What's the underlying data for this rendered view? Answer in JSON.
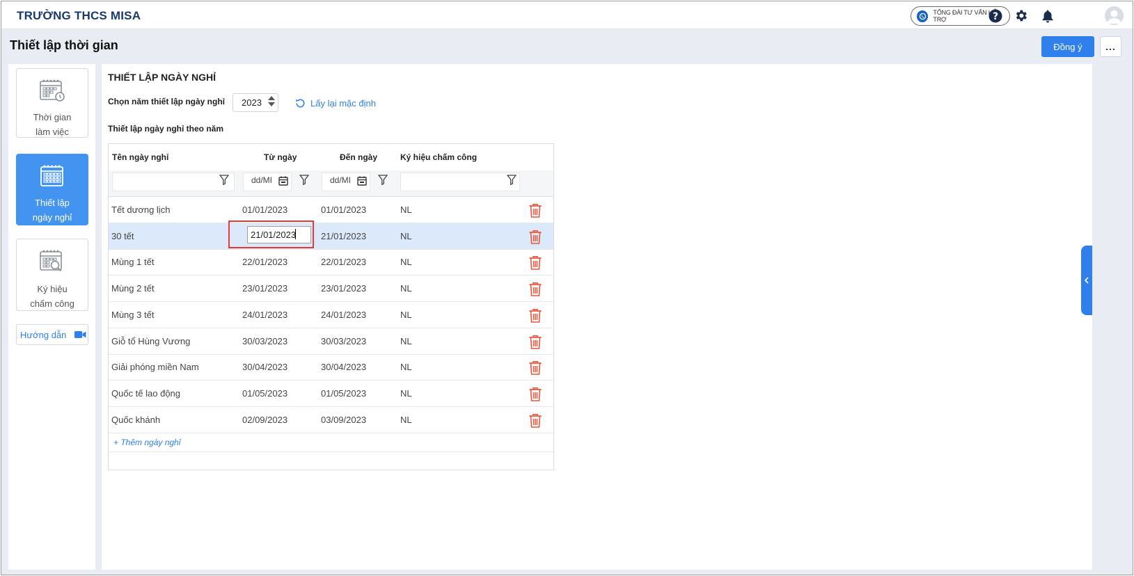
{
  "topbar": {
    "school_name": "TRƯỜNG THCS MISA",
    "hotline_label": "TỔNG ĐÀI TƯ VẤN HỖ TRỢ",
    "icons": [
      "help-icon",
      "settings-gear-icon",
      "notification-bell-icon",
      "user-avatar"
    ]
  },
  "header": {
    "title": "Thiết lập thời gian",
    "confirm_label": "Đồng ý",
    "more_label": "..."
  },
  "sidebar": {
    "items": [
      {
        "label": "Thời gian\nlàm việc",
        "icon": "calendar-clock-icon",
        "active": false
      },
      {
        "label": "Thiết lập\nngày nghỉ",
        "icon": "calendar-icon",
        "active": true
      },
      {
        "label": "Ký hiệu\nchấm công",
        "icon": "calendar-search-icon",
        "active": false
      }
    ],
    "guide_label": "Hướng dẫn",
    "guide_icon": "video-camera-icon"
  },
  "main": {
    "section_title": "THIẾT LẬP NGÀY NGHỈ",
    "year_label": "Chọn năm thiết lập ngày nghỉ",
    "year_value": "2023",
    "reset_label": "Lấy lại mặc định",
    "subsection_label": "Thiết lập ngày nghỉ theo năm",
    "table": {
      "columns": [
        "Tên ngày nghỉ",
        "Từ ngày",
        "Đến ngày",
        "Ký hiệu chấm công"
      ],
      "date_placeholder": "dd/MI",
      "rows": [
        {
          "name": "Tết dương lịch",
          "from": "01/01/2023",
          "to": "01/01/2023",
          "code": "NL"
        },
        {
          "name": "30 tết",
          "from": "21/01/2023",
          "to": "21/01/2023",
          "code": "NL"
        },
        {
          "name": "Mùng 1 tết",
          "from": "22/01/2023",
          "to": "22/01/2023",
          "code": "NL"
        },
        {
          "name": "Mùng 2 tết",
          "from": "23/01/2023",
          "to": "23/01/2023",
          "code": "NL"
        },
        {
          "name": "Mùng 3 tết",
          "from": "24/01/2023",
          "to": "24/01/2023",
          "code": "NL"
        },
        {
          "name": "Giỗ tổ Hùng Vương",
          "from": "30/03/2023",
          "to": "30/03/2023",
          "code": "NL"
        },
        {
          "name": "Giải phóng miền Nam",
          "from": "30/04/2023",
          "to": "30/04/2023",
          "code": "NL"
        },
        {
          "name": "Quốc tế lao động",
          "from": "01/05/2023",
          "to": "01/05/2023",
          "code": "NL"
        },
        {
          "name": "Quốc khánh",
          "from": "02/09/2023",
          "to": "03/09/2023",
          "code": "NL"
        }
      ],
      "selected_row": 1,
      "editing_value": "21/01/2023",
      "add_label": "+ Thêm ngày nghỉ"
    }
  },
  "colors": {
    "primary": "#2f80ed",
    "active_nav": "#4294f0",
    "selected_row": "#dbe9fb",
    "delete": "#e8553b",
    "highlight_border": "#e53935"
  }
}
